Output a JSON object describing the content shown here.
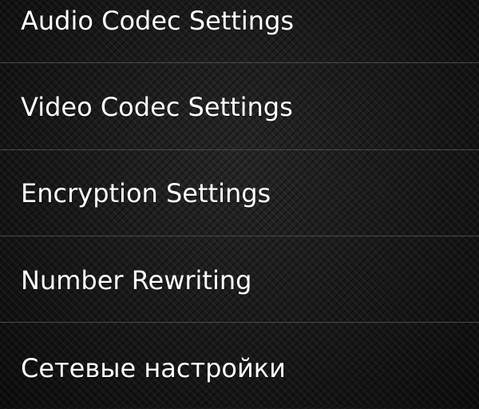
{
  "settings_menu": {
    "items": [
      {
        "label": "Audio Codec Settings"
      },
      {
        "label": "Video Codec Settings"
      },
      {
        "label": "Encryption Settings"
      },
      {
        "label": "Number Rewriting"
      },
      {
        "label": "Сетевые настройки"
      }
    ]
  },
  "colors": {
    "background": "#141414",
    "text": "#ffffff",
    "divider": "#4a4a4a"
  }
}
